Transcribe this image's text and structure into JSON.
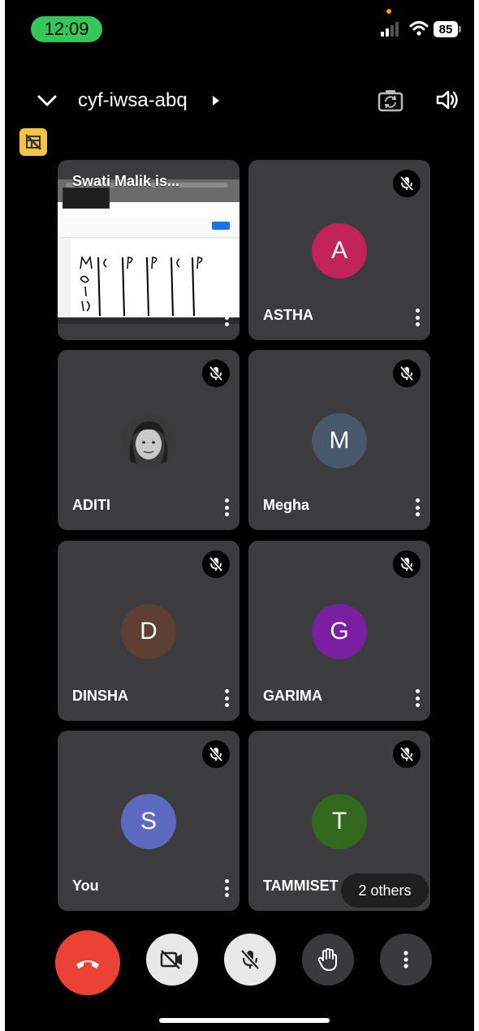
{
  "status_bar": {
    "time": "12:09",
    "battery": "85",
    "time_pill_color": "#34c759"
  },
  "top_bar": {
    "meeting_code": "cyf-iwsa-abq",
    "icons": [
      "chevron-down-icon",
      "caret-right-icon",
      "switch-camera-icon",
      "speaker-icon"
    ]
  },
  "pin_button": {
    "icon": "pin-layout-icon",
    "color": "#f6c344"
  },
  "tiles": [
    {
      "name": "Swati Malik is...",
      "kind": "screen-share",
      "muted": false
    },
    {
      "name": "ASTHA",
      "initial": "A",
      "avatar_color": "#c2245a",
      "muted": true
    },
    {
      "name": "ADITI",
      "kind": "photo",
      "muted": true
    },
    {
      "name": "Megha",
      "initial": "M",
      "avatar_color": "#47596a",
      "muted": true
    },
    {
      "name": "DINSHA",
      "initial": "D",
      "avatar_color": "#5d3f33",
      "muted": true
    },
    {
      "name": "GARIMA",
      "initial": "G",
      "avatar_color": "#7b1fa2",
      "muted": true
    },
    {
      "name": "You",
      "initial": "S",
      "avatar_color": "#5c6bc0",
      "muted": true
    },
    {
      "name": "TAMMISET",
      "initial": "T",
      "avatar_color": "#33691e",
      "muted": true
    }
  ],
  "others_pill": "2 others",
  "controls": {
    "end_call_icon": "end-call-icon",
    "end_call_color": "#ea4335",
    "camera_icon": "camera-off-icon",
    "mic_icon": "mic-off-icon",
    "hand_icon": "raise-hand-icon",
    "more_icon": "more-vertical-icon"
  }
}
